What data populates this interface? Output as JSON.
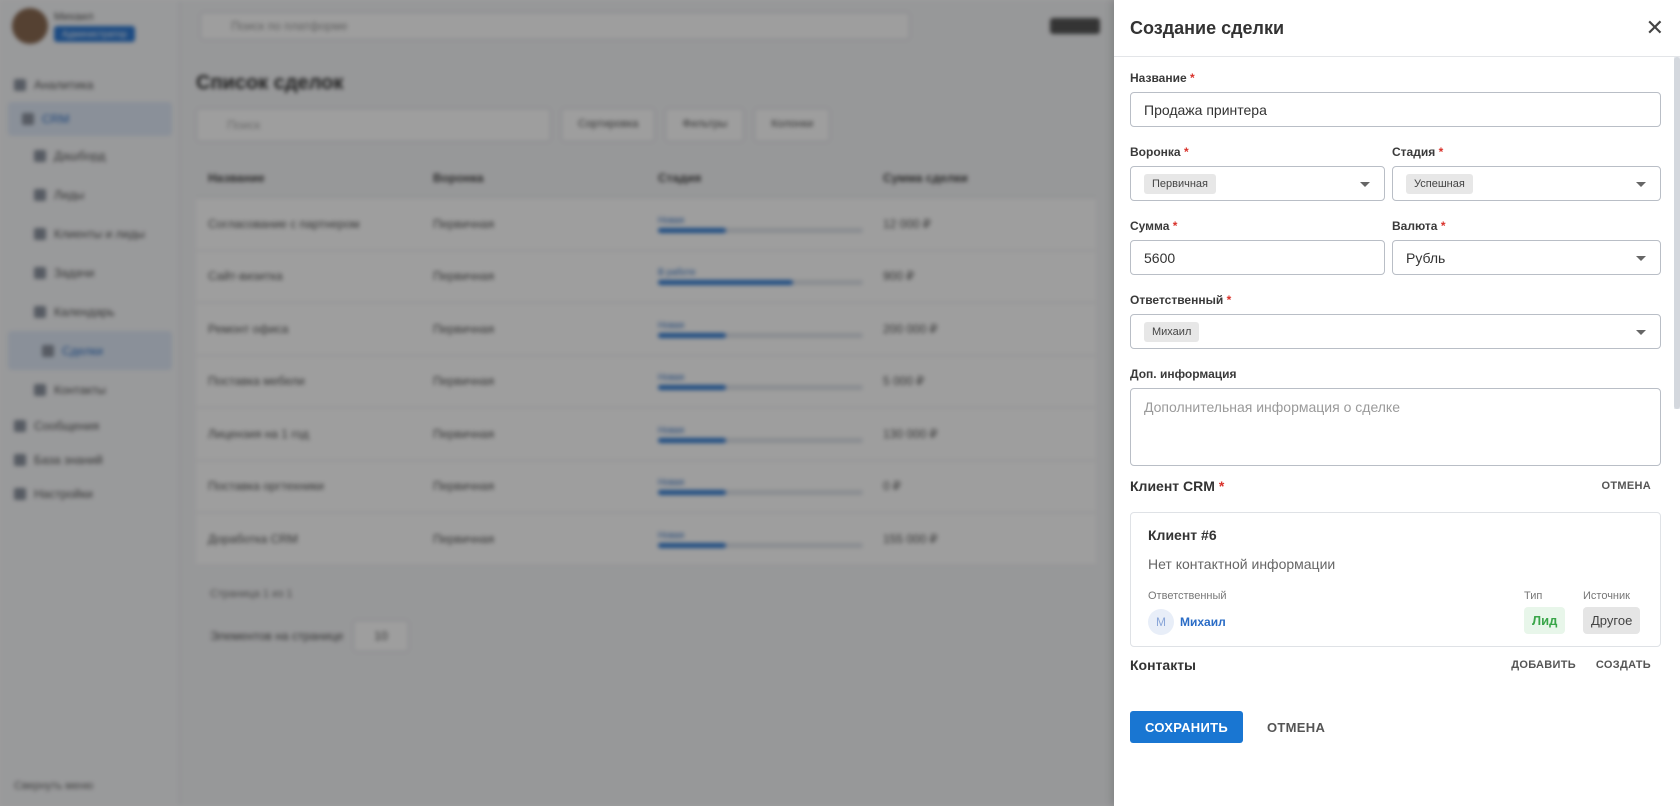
{
  "background": {
    "user": {
      "name": "Михаил",
      "role": "Администратор"
    },
    "nav": [
      {
        "label": "Аналитика",
        "sub": false,
        "active": false
      },
      {
        "label": "CRM",
        "sub": false,
        "active": true
      },
      {
        "label": "Дашборд",
        "sub": true,
        "active": false
      },
      {
        "label": "Лиды",
        "sub": true,
        "active": false
      },
      {
        "label": "Клиенты и лиды",
        "sub": true,
        "active": false
      },
      {
        "label": "Задачи",
        "sub": true,
        "active": false
      },
      {
        "label": "Календарь",
        "sub": true,
        "active": false
      },
      {
        "label": "Сделки",
        "sub": true,
        "active": true
      },
      {
        "label": "Контакты",
        "sub": true,
        "active": false
      },
      {
        "label": "Сообщения",
        "sub": false,
        "active": false
      },
      {
        "label": "База знаний",
        "sub": false,
        "active": false
      },
      {
        "label": "Настройки",
        "sub": false,
        "active": false
      }
    ],
    "nav_bottom": "Свернуть меню",
    "search_placeholder": "Поиск по платформе",
    "page_title": "Список сделок",
    "toolbar": {
      "search": "Поиск",
      "sort": "Сортировка",
      "filter": "Фильтры",
      "columns": "Колонки"
    },
    "columns": [
      "Название",
      "Воронка",
      "Стадия",
      "Сумма сделки"
    ],
    "rows": [
      {
        "name": "Согласование с партнером",
        "funnel": "Первичная",
        "stage": "Новая",
        "progress": 0.33,
        "sum": "12 000 ₽"
      },
      {
        "name": "Сайт-визитка",
        "funnel": "Первичная",
        "stage": "В работе",
        "progress": 0.66,
        "sum": "900 ₽"
      },
      {
        "name": "Ремонт офиса",
        "funnel": "Первичная",
        "stage": "Новая",
        "progress": 0.33,
        "sum": "200 000 ₽"
      },
      {
        "name": "Поставка мебели",
        "funnel": "Первичная",
        "stage": "Новая",
        "progress": 0.33,
        "sum": "5 000 ₽"
      },
      {
        "name": "Лицензия на 1 год",
        "funnel": "Первичная",
        "stage": "Новая",
        "progress": 0.33,
        "sum": "130 000 ₽"
      },
      {
        "name": "Поставка оргтехники",
        "funnel": "Первичная",
        "stage": "Новая",
        "progress": 0.33,
        "sum": "0 ₽"
      },
      {
        "name": "Доработка CRM",
        "funnel": "Первичная",
        "stage": "Новая",
        "progress": 0.33,
        "sum": "155 000 ₽"
      }
    ],
    "pager": "Страница 1 из 1",
    "per_page_label": "Элементов на странице",
    "per_page_value": "10"
  },
  "drawer": {
    "title": "Создание сделки",
    "close_icon": "close-icon",
    "name_label": "Название",
    "name_value": "Продажа принтера",
    "funnel_label": "Воронка",
    "funnel_value": "Первичная",
    "stage_label": "Стадия",
    "stage_value": "Успешная",
    "sum_label": "Сумма",
    "sum_value": "5600",
    "currency_label": "Валюта",
    "currency_value": "Рубль",
    "responsible_label": "Ответственный",
    "responsible_value": "Михаил",
    "extra_label": "Доп. информация",
    "extra_placeholder": "Дополнительная информация о сделке",
    "required_mark": "*",
    "client_section": "Клиент CRM",
    "client_cancel": "ОТМЕНА",
    "client": {
      "name": "Клиент #6",
      "info": "Нет контактной информации",
      "responsible_label": "Ответственный",
      "responsible_initial": "М",
      "responsible_name": "Михаил",
      "type_label": "Тип",
      "type_value": "Лид",
      "source_label": "Источник",
      "source_value": "Другое"
    },
    "contacts_section": "Контакты",
    "contacts_add": "ДОБАВИТЬ",
    "contacts_create": "СОЗДАТЬ",
    "save": "СОХРАНИТЬ",
    "cancel": "ОТМЕНА"
  },
  "colors": {
    "primary": "#1976d2",
    "required": "#d9322b",
    "lead_green": "#3aa64a"
  }
}
